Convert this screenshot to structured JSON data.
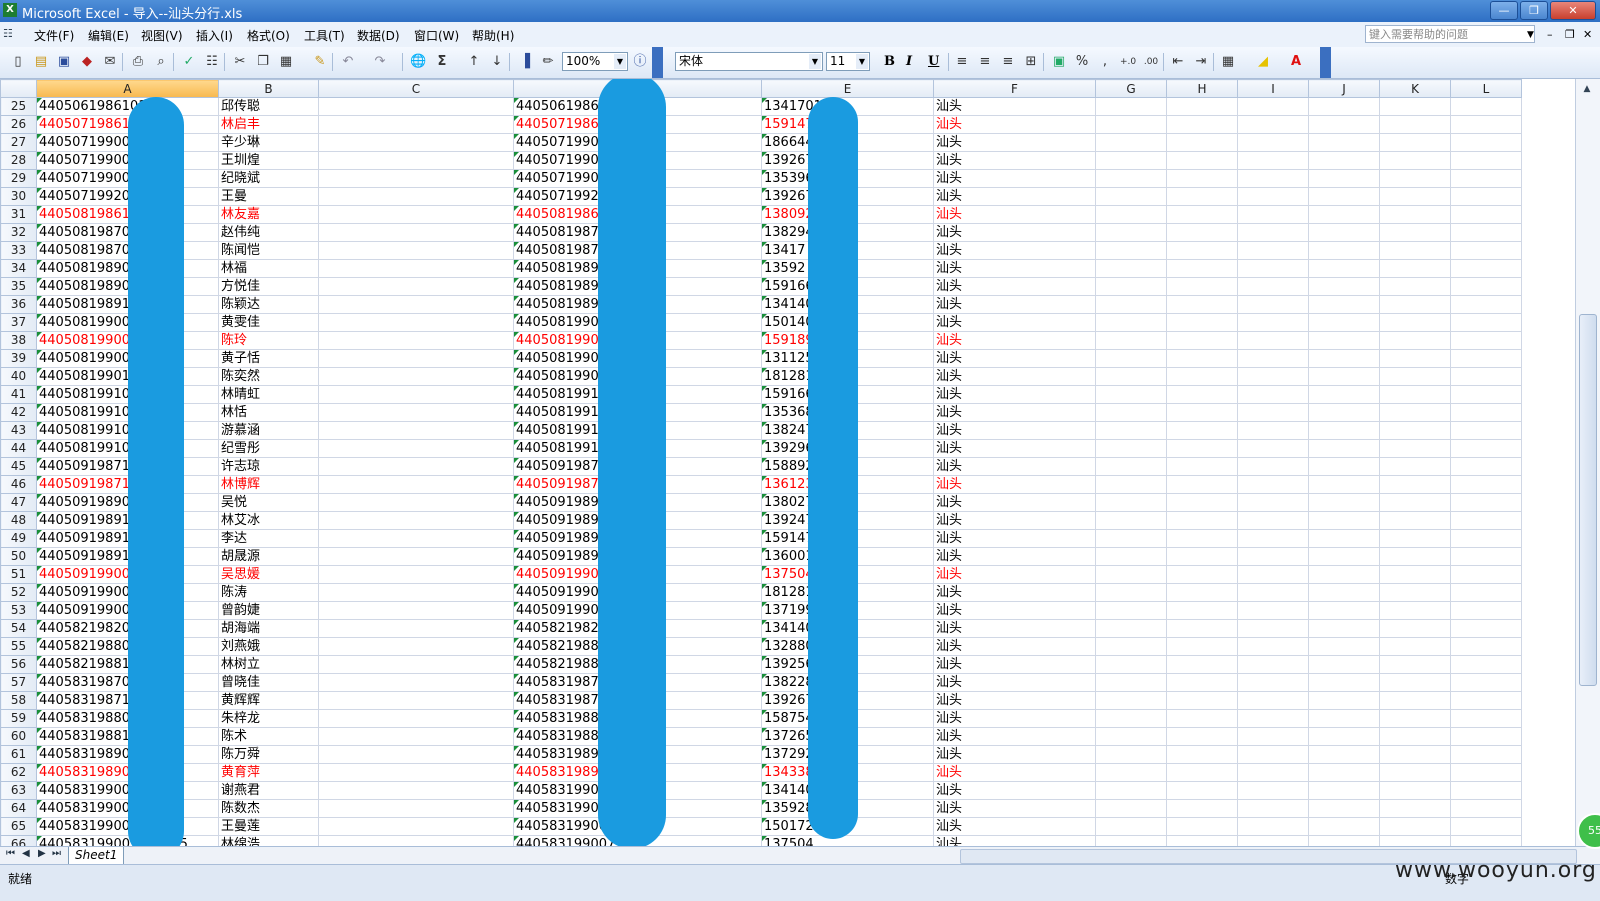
{
  "window": {
    "title": "Microsoft Excel - 导入--汕头分行.xls",
    "app_icon": "X"
  },
  "menu": {
    "items": [
      "文件(F)",
      "编辑(E)",
      "视图(V)",
      "插入(I)",
      "格式(O)",
      "工具(T)",
      "数据(D)",
      "窗口(W)",
      "帮助(H)"
    ],
    "help_placeholder": "键入需要帮助的问题"
  },
  "toolbar": {
    "zoom": "100%",
    "font": "宋体",
    "font_size": "11"
  },
  "columns": [
    "A",
    "B",
    "C",
    "D",
    "E",
    "F",
    "G",
    "H",
    "I",
    "J",
    "K",
    "L"
  ],
  "rows": [
    {
      "n": "25",
      "a": "44050619861016",
      "b": "邱传聪",
      "d": "44050619861",
      "e": "13417010",
      "f": "汕头",
      "red": false
    },
    {
      "n": "26",
      "a": "44050719861102",
      "b": "林启丰",
      "d": "44050719861",
      "e": "159147",
      "f": "汕头",
      "red": true
    },
    {
      "n": "27",
      "a": "44050719900205",
      "b": "辛少琳",
      "d": "44050719900",
      "e": "186644",
      "f": "汕头",
      "red": false
    },
    {
      "n": "28",
      "a": "44050719900502",
      "b": "王圳煌",
      "d": "44050719900",
      "e": "139267",
      "f": "汕头",
      "red": false
    },
    {
      "n": "29",
      "a": "44050719900602",
      "b": "纪晓斌",
      "d": "44050719900",
      "e": "135396",
      "f": "汕头",
      "red": false
    },
    {
      "n": "30",
      "a": "44050719920212",
      "b": "王曼",
      "d": "44050719920",
      "e": "1392675",
      "f": "汕头",
      "red": false
    },
    {
      "n": "31",
      "a": "44050819861130",
      "b": "林友嘉",
      "d": "44050819861",
      "e": "138092",
      "f": "汕头",
      "red": true
    },
    {
      "n": "32",
      "a": "44050819870512",
      "b": "赵伟纯",
      "d": "44050819870",
      "e": "138294",
      "f": "汕头",
      "red": false
    },
    {
      "n": "33",
      "a": "44050819870701",
      "b": "陈闻恺",
      "d": "44050819870704",
      "e": "13417",
      "f": "汕头",
      "red": false
    },
    {
      "n": "34",
      "a": "44050819890220",
      "b": "林福",
      "d": "440508198902",
      "e": "13592",
      "f": "汕头",
      "red": false
    },
    {
      "n": "35",
      "a": "44050819890917",
      "b": "方悦佳",
      "d": "44050819890917",
      "e": "1591664",
      "f": "汕头",
      "red": false
    },
    {
      "n": "36",
      "a": "44050819891010",
      "b": "陈颖达",
      "d": "44050819891010",
      "e": "13414076",
      "f": "汕头",
      "red": false
    },
    {
      "n": "37",
      "a": "44050819900103",
      "b": "黄雯佳",
      "d": "44050819900103",
      "e": "15014023848",
      "f": "汕头",
      "red": false
    },
    {
      "n": "38",
      "a": "44050819900307",
      "b": "陈玲",
      "d": "44050819900",
      "e": "15918978958",
      "f": "汕头",
      "red": true
    },
    {
      "n": "39",
      "a": "44050819900506",
      "b": "黄子恬",
      "d": "44050819900",
      "e": "13112540",
      "f": "汕头",
      "red": false
    },
    {
      "n": "40",
      "a": "44050819901000",
      "b": "陈奕然",
      "d": "44050819901",
      "e": "181281",
      "f": "汕头",
      "red": false
    },
    {
      "n": "41",
      "a": "44050819910126",
      "b": "林晴虹",
      "d": "44050819910",
      "e": "159166",
      "f": "汕头",
      "red": false
    },
    {
      "n": "42",
      "a": "44050819910701",
      "b": "林恬",
      "d": "44050819910",
      "e": "135368",
      "f": "汕头",
      "red": false
    },
    {
      "n": "43",
      "a": "44050819910806",
      "b": "游慕涵",
      "d": "44050819910",
      "e": "138247",
      "f": "汕头",
      "red": false
    },
    {
      "n": "44",
      "a": "44050819910905",
      "b": "纪雪彤",
      "d": "44050819910",
      "e": "139296",
      "f": "汕头",
      "red": false
    },
    {
      "n": "45",
      "a": "44050919871005",
      "b": "许志琼",
      "d": "44050919871",
      "e": "158892",
      "f": "汕头",
      "red": false
    },
    {
      "n": "46",
      "a": "44050919871209",
      "b": "林博辉",
      "d": "44050919871",
      "e": "136123",
      "f": "汕头",
      "red": true
    },
    {
      "n": "47",
      "a": "44050919890105",
      "b": "吴悦",
      "d": "44050919890",
      "e": "138027",
      "f": "汕头",
      "red": false
    },
    {
      "n": "48",
      "a": "44050919891106",
      "b": "林艾冰",
      "d": "44050919891",
      "e": "139247",
      "f": "汕头",
      "red": false
    },
    {
      "n": "49",
      "a": "44050919891107",
      "b": "李达",
      "d": "44050919891",
      "e": "159147",
      "f": "汕头",
      "red": false
    },
    {
      "n": "50",
      "a": "44050919891107",
      "b": "胡晟源",
      "d": "44050919891",
      "e": "136001",
      "f": "汕头",
      "red": false
    },
    {
      "n": "51",
      "a": "44050919900207",
      "b": "吴思媛",
      "d": "44050919900",
      "e": "137504",
      "f": "汕头",
      "red": true
    },
    {
      "n": "52",
      "a": "44050919900602",
      "b": "陈涛",
      "d": "44050919900",
      "e": "181281",
      "f": "汕头",
      "red": false
    },
    {
      "n": "53",
      "a": "44050919900803",
      "b": "曾韵婕",
      "d": "44050919900",
      "e": "137199",
      "f": "汕头",
      "red": false
    },
    {
      "n": "54",
      "a": "44058219820903",
      "b": "胡海端",
      "d": "44058219820",
      "e": "134140",
      "f": "汕头",
      "red": false
    },
    {
      "n": "55",
      "a": "44058219880106",
      "b": "刘燕娥",
      "d": "44058219880",
      "e": "132880",
      "f": "汕头",
      "red": false
    },
    {
      "n": "56",
      "a": "44058219881007",
      "b": "林树立",
      "d": "44058219881",
      "e": "139256",
      "f": "汕头",
      "red": false
    },
    {
      "n": "57",
      "a": "44058319870205",
      "b": "曾晓佳",
      "d": "44058319870",
      "e": "138228",
      "f": "汕头",
      "red": false
    },
    {
      "n": "58",
      "a": "44058319871009",
      "b": "黄辉辉",
      "d": "44058319871",
      "e": "139267",
      "f": "汕头",
      "red": false
    },
    {
      "n": "59",
      "a": "44058319880702",
      "b": "朱梓龙",
      "d": "44058319880",
      "e": "158754",
      "f": "汕头",
      "red": false
    },
    {
      "n": "60",
      "a": "44058319881103",
      "b": "陈术",
      "d": "44058319881",
      "e": "137265",
      "f": "汕头",
      "red": false
    },
    {
      "n": "61",
      "a": "44058319890103",
      "b": "陈万舜",
      "d": "44058319890",
      "e": "137292",
      "f": "汕头",
      "red": false
    },
    {
      "n": "62",
      "a": "44058319890506",
      "b": "黄育萍",
      "d": "44058319890",
      "e": "134338",
      "f": "汕头",
      "red": true
    },
    {
      "n": "63",
      "a": "44058319900302",
      "b": "谢燕君",
      "d": "44058319900",
      "e": "134140",
      "f": "汕头",
      "red": false
    },
    {
      "n": "64",
      "a": "44058319900501",
      "b": "陈数杰",
      "d": "44058319900",
      "e": "135928",
      "f": "汕头",
      "red": false
    },
    {
      "n": "65",
      "a": "44058319900602",
      "b": "王曼莲",
      "d": "44058319900",
      "e": "150172",
      "f": "汕头",
      "red": false
    },
    {
      "n": "66",
      "a": "440583199007101305",
      "b": "林绵浩",
      "d": "44058319900710",
      "e": "137504",
      "f": "汕头",
      "red": false
    }
  ],
  "sheet_tab": "Sheet1",
  "status": {
    "ready": "就绪",
    "mode": "数字"
  },
  "watermark": "www.wooyun.org",
  "badge": "55"
}
